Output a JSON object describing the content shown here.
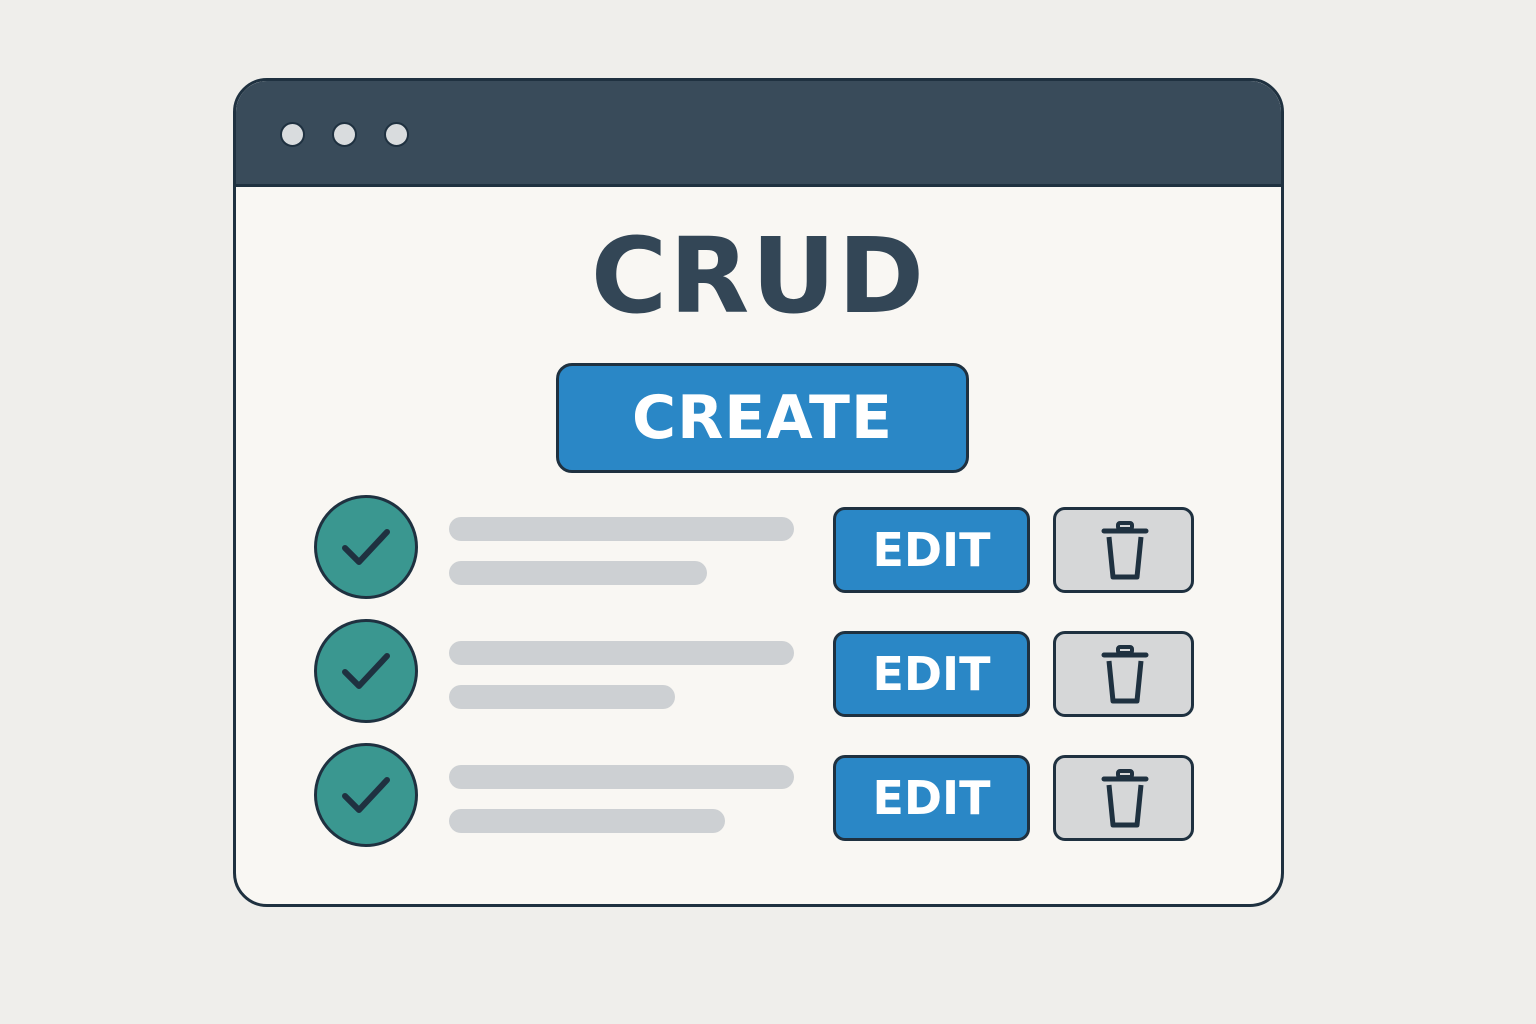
{
  "window": {
    "controls": [
      "dot",
      "dot",
      "dot"
    ]
  },
  "title": "CRUD",
  "create_button": {
    "label": "CREATE"
  },
  "items": [
    {
      "status": "checked",
      "edit_label": "EDIT",
      "delete_icon": "trash-icon"
    },
    {
      "status": "checked",
      "edit_label": "EDIT",
      "delete_icon": "trash-icon"
    },
    {
      "status": "checked",
      "edit_label": "EDIT",
      "delete_icon": "trash-icon"
    }
  ],
  "colors": {
    "titlebar": "#394b5a",
    "title_text": "#334656",
    "primary_button": "#2a87c6",
    "check_circle": "#3a9790",
    "delete_button": "#d6d7d8",
    "placeholder_line": "#cdd0d3",
    "outline": "#1f3140"
  }
}
